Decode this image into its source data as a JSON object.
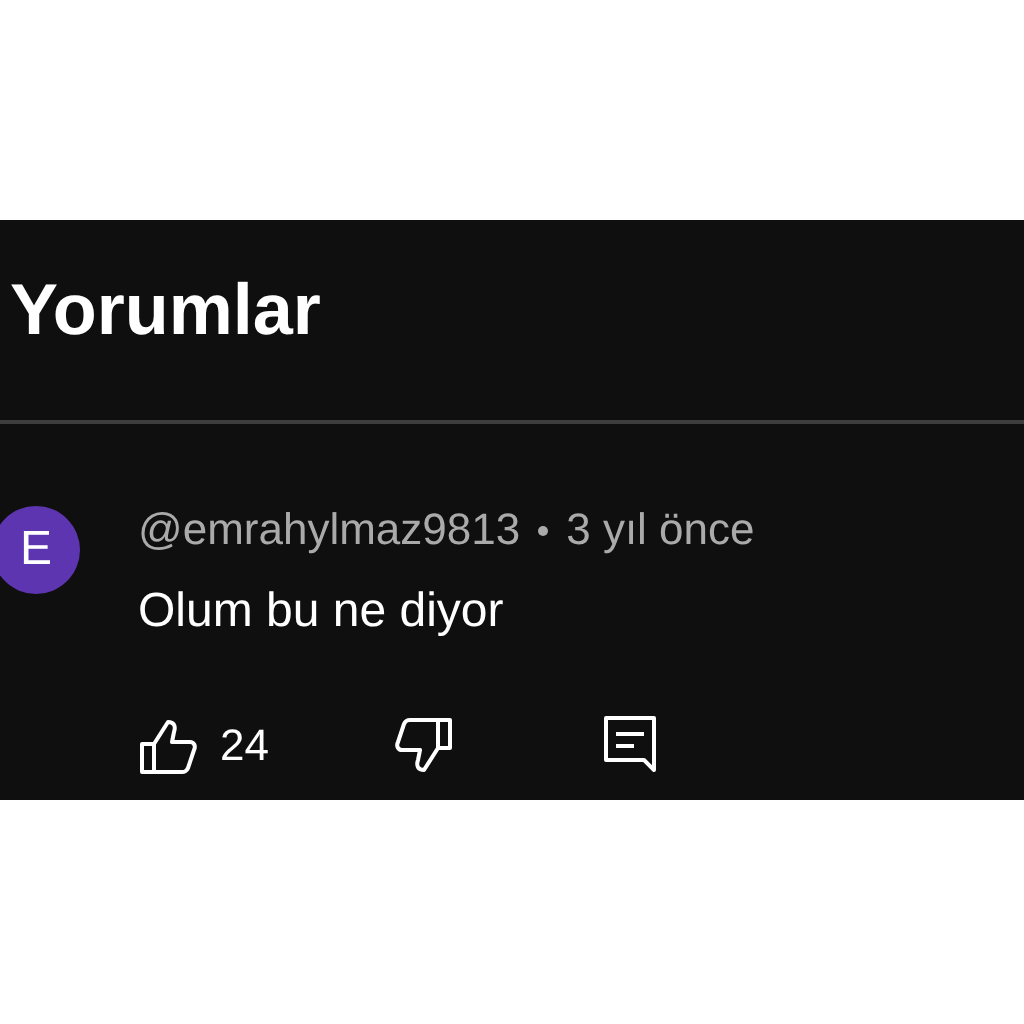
{
  "title": "Yorumlar",
  "comments": [
    {
      "avatar_letter": "E",
      "author": "@emrahylmaz9813",
      "time": "3 yıl önce",
      "text": "Olum bu ne diyor",
      "likes": "24"
    }
  ]
}
